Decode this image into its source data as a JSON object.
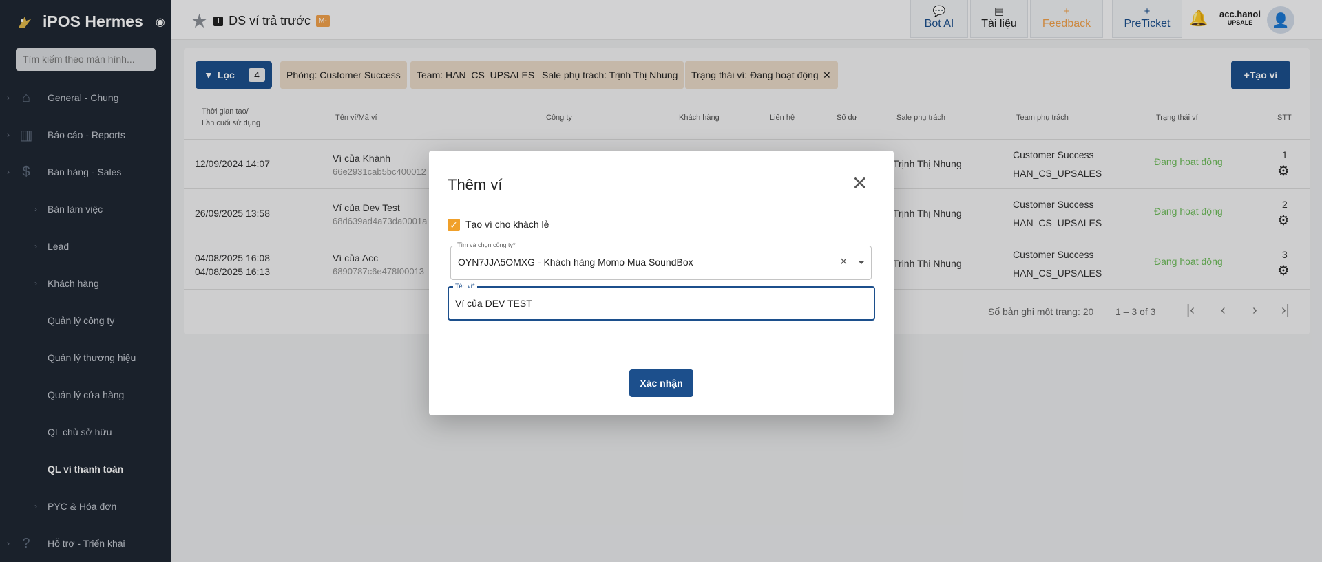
{
  "sidebar": {
    "app_title": "iPOS Hermes",
    "search_placeholder": "Tìm kiếm theo màn hình...",
    "items": [
      {
        "label": "General - Chung"
      },
      {
        "label": "Báo cáo - Reports"
      },
      {
        "label": "Bán hàng - Sales"
      },
      {
        "label": "Bàn làm việc"
      },
      {
        "label": "Lead"
      },
      {
        "label": "Khách hàng"
      },
      {
        "label": "Quản lý công ty"
      },
      {
        "label": "Quản lý thương hiệu"
      },
      {
        "label": "Quản lý cửa hàng"
      },
      {
        "label": "QL chủ sở hữu"
      },
      {
        "label": "QL ví thanh toán"
      },
      {
        "label": "PYC & Hóa đơn"
      },
      {
        "label": "Hỗ trợ - Triển khai"
      }
    ]
  },
  "header": {
    "page_title": "DS ví trả trước",
    "badge": "M-",
    "buttons": {
      "bot_ai": "Bot AI",
      "docs": "Tài liệu",
      "feedback": "Feedback",
      "preticket": "PreTicket"
    },
    "user_name": "acc.hanoi",
    "user_role": "UPSALE"
  },
  "filters": {
    "button_label": "Lọc",
    "count": "4",
    "chips": [
      "Phòng: Customer Success",
      "Team: HAN_CS_UPSALES",
      "Sale phụ trách: Trịnh Thị Nhung",
      "Trạng thái ví: Đang hoạt động"
    ],
    "create_label": "Tạo ví"
  },
  "table": {
    "headers": {
      "created_line1": "Thời gian tạo/",
      "created_line2": "Lần cuối sử dụng",
      "wallet": "Tên ví/Mã ví",
      "company": "Công ty",
      "customer": "Khách hàng",
      "contact": "Liên hệ",
      "balance": "Số dư",
      "sale": "Sale phụ trách",
      "team": "Team phụ trách",
      "status": "Trạng thái ví",
      "stt": "STT"
    },
    "rows": [
      {
        "created": "12/09/2024 14:07",
        "last_used": "",
        "wallet_name": "Ví của Khánh",
        "wallet_code": "66e2931cab5bc400012",
        "sale": "Trịnh Thị Nhung",
        "dept": "Customer Success",
        "team": "HAN_CS_UPSALES",
        "status": "Đang hoạt động",
        "stt": "1"
      },
      {
        "created": "26/09/2025 13:58",
        "last_used": "",
        "wallet_name": "Ví của Dev Test",
        "wallet_code": "68d639ad4a73da0001a",
        "sale": "Trịnh Thị Nhung",
        "dept": "Customer Success",
        "team": "HAN_CS_UPSALES",
        "status": "Đang hoạt động",
        "stt": "2"
      },
      {
        "created": "04/08/2025 16:08",
        "last_used": "04/08/2025 16:13",
        "wallet_name": "Ví của Acc",
        "wallet_code": "6890787c6e478f00013",
        "sale": "Trịnh Thị Nhung",
        "dept": "Customer Success",
        "team": "HAN_CS_UPSALES",
        "status": "Đang hoạt động",
        "stt": "3"
      }
    ],
    "pager": {
      "rows_per_page": "Số bản ghi một trang: 20",
      "range": "1 – 3 of 3"
    }
  },
  "modal": {
    "title": "Thêm ví",
    "checkbox_label": "Tạo ví cho khách lẻ",
    "company_label": "Tìm và chọn công ty*",
    "company_value": "OYN7JJA5OMXG - Khách hàng Momo Mua SoundBox",
    "name_label": "Tên ví*",
    "name_value": "Ví của DEV TEST",
    "confirm_label": "Xác nhận"
  }
}
